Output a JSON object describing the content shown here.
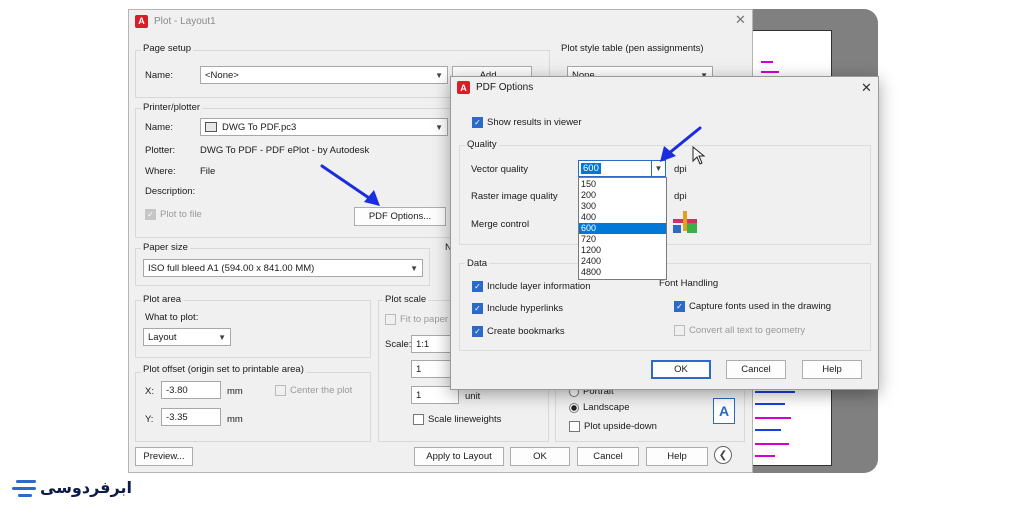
{
  "plot_dialog": {
    "title": "Plot - Layout1",
    "page_setup": {
      "group_label": "Page setup",
      "name_label": "Name:",
      "name_value": "<None>",
      "add_label": "Add..."
    },
    "plot_style_table": {
      "group_label": "Plot style table (pen assignments)",
      "value": "None"
    },
    "printer": {
      "group_label": "Printer/plotter",
      "name_label": "Name:",
      "name_value": "DWG To PDF.pc3",
      "plotter_label": "Plotter:",
      "plotter_value": "DWG To PDF - PDF ePlot - by Autodesk",
      "where_label": "Where:",
      "where_value": "File",
      "description_label": "Description:",
      "plot_to_file_label": "Plot to file",
      "pdf_options_label": "PDF Options..."
    },
    "paper_size": {
      "group_label": "Paper size",
      "value": "ISO full bleed A1 (594.00 x 841.00 MM)",
      "side_label": "N"
    },
    "plot_area": {
      "group_label": "Plot area",
      "what_label": "What to plot:",
      "what_value": "Layout"
    },
    "plot_scale": {
      "group_label": "Plot scale",
      "fit_label": "Fit to paper",
      "scale_label": "Scale:",
      "scale_value": "1:1",
      "value_1": "1",
      "value_2": "1",
      "unit_label": "unit",
      "scale_lineweights_label": "Scale lineweights"
    },
    "plot_offset": {
      "group_label": "Plot offset (origin set to printable area)",
      "x_label": "X:",
      "x_value": "-3.80",
      "x_unit": "mm",
      "y_label": "Y:",
      "y_value": "-3.35",
      "y_unit": "mm",
      "center_label": "Center the plot"
    },
    "orientation": {
      "portrait_label": "Portrait",
      "landscape_label": "Landscape",
      "upside_down_label": "Plot upside-down"
    },
    "buttons": {
      "preview": "Preview...",
      "apply": "Apply to Layout",
      "ok": "OK",
      "cancel": "Cancel",
      "help": "Help"
    }
  },
  "pdf_dialog": {
    "title": "PDF Options",
    "show_results_label": "Show results in viewer",
    "quality": {
      "group_label": "Quality",
      "vector_label": "Vector quality",
      "vector_value": "600",
      "dpi_label_1": "dpi",
      "raster_label": "Raster image quality",
      "dpi_label_2": "dpi",
      "merge_label": "Merge control",
      "options": [
        "150",
        "200",
        "300",
        "400",
        "600",
        "720",
        "1200",
        "2400",
        "4800"
      ],
      "selected_option": "600"
    },
    "data": {
      "group_label": "Data",
      "layer_label": "Include layer information",
      "hyperlinks_label": "Include hyperlinks",
      "bookmarks_label": "Create bookmarks"
    },
    "font_handling": {
      "group_label": "Font Handling",
      "capture_label": "Capture fonts used in the drawing",
      "convert_label": "Convert all text to geometry"
    },
    "buttons": {
      "ok": "OK",
      "cancel": "Cancel",
      "help": "Help"
    }
  },
  "watermark": {
    "brand": "ابرفردوسی"
  },
  "colors": {
    "accent": "#2b6ac9",
    "arrow": "#1a2ee0",
    "autocad_red": "#d71f28"
  }
}
